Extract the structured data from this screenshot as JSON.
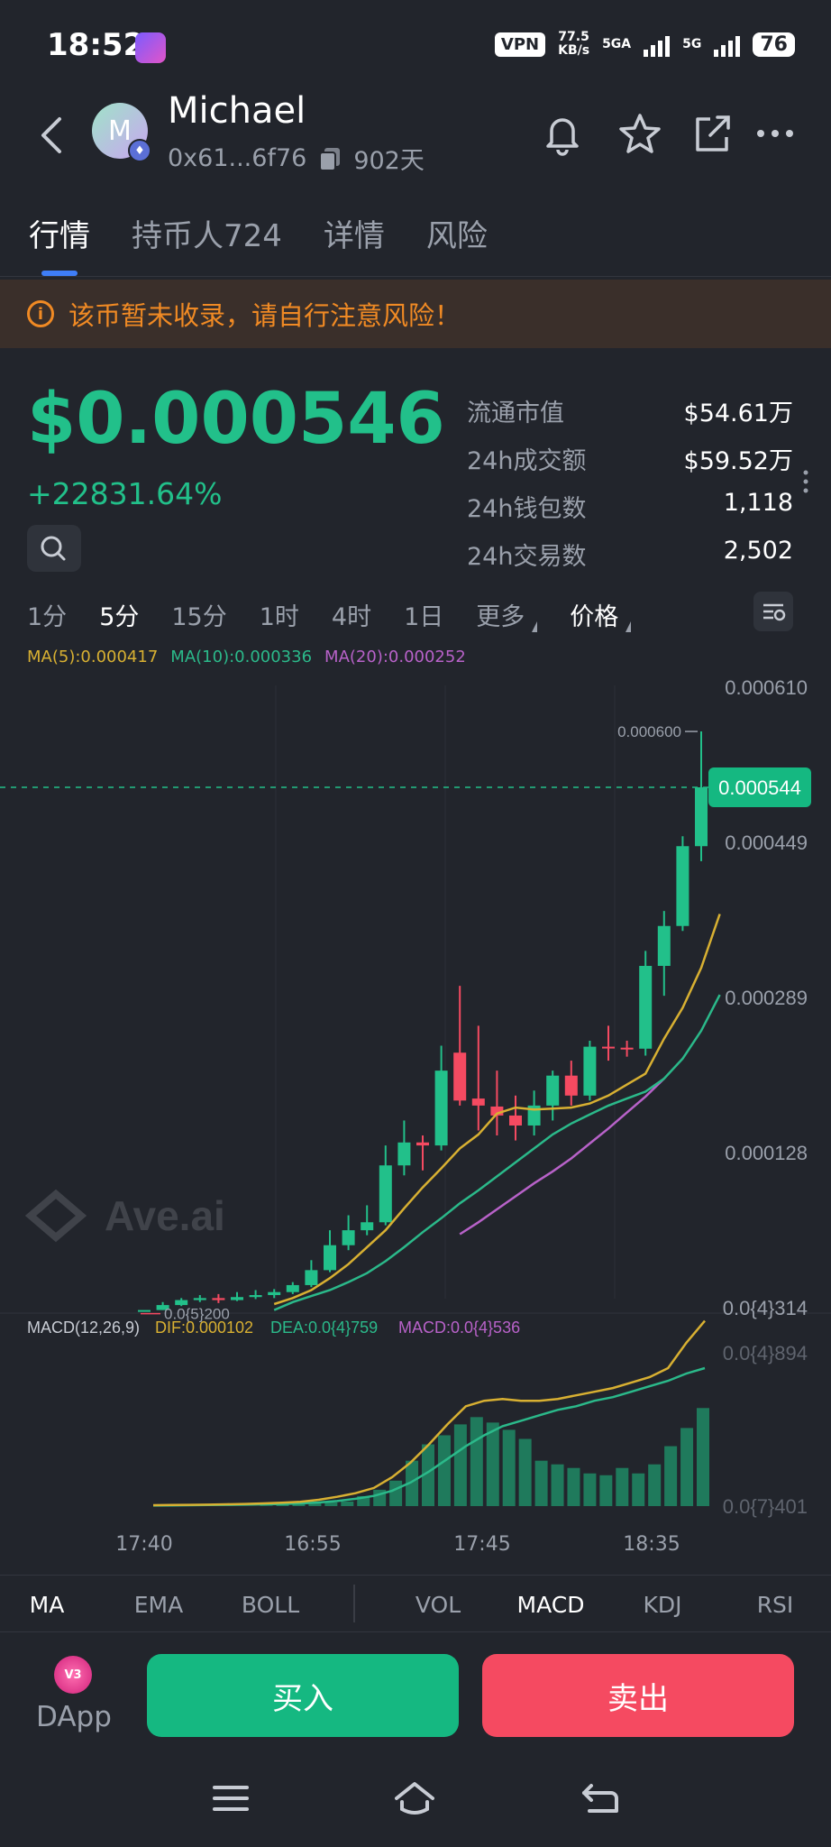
{
  "status_bar": {
    "time": "18:52",
    "vpn": "VPN",
    "net_speed_value": "77.5",
    "net_speed_unit": "KB/s",
    "sim1": "5GA",
    "sim2": "5G",
    "battery": "76"
  },
  "header": {
    "token_name": "Michael",
    "avatar_letter": "M",
    "address": "0x61...6f76",
    "age": "902天"
  },
  "tabs": [
    {
      "label": "行情"
    },
    {
      "label": "持币人724"
    },
    {
      "label": "详情"
    },
    {
      "label": "风险"
    }
  ],
  "warning": {
    "icon": "i",
    "text": "该币暂未收录，请自行注意风险！"
  },
  "price": {
    "value": "$0.000546",
    "change": "+22831.64%"
  },
  "stats": [
    {
      "label": "流通市值",
      "value": "$54.61万"
    },
    {
      "label": "24h成交额",
      "value": "$59.52万"
    },
    {
      "label": "24h钱包数",
      "value": "1,118"
    },
    {
      "label": "24h交易数",
      "value": "2,502"
    }
  ],
  "timeframes": [
    "1分",
    "5分",
    "15分",
    "1时",
    "4时",
    "1日",
    "更多",
    "价格"
  ],
  "ma_legend": [
    {
      "text": "MA(5):0.000417",
      "color": "#d8b032"
    },
    {
      "text": "MA(10):0.000336",
      "color": "#2bb98a"
    },
    {
      "text": "MA(20):0.000252",
      "color": "#b862c9"
    }
  ],
  "chart": {
    "watermark": "Ave.ai",
    "y_labels": [
      "0.000610",
      "0.000449",
      "0.000289",
      "0.000128",
      "0.0{4}314"
    ],
    "current_price_tag": "0.000544",
    "high_marker": "0.000600",
    "low_marker": "0.0{5}200",
    "up_color": "#22c08a",
    "down_color": "#f54a61"
  },
  "chart_data": {
    "type": "candlestick",
    "interval": "5分",
    "candles": [
      {
        "o": 2e-05,
        "c": 2e-05,
        "h": 2e-05,
        "l": 2e-05
      },
      {
        "o": 2e-05,
        "c": 2.5e-05,
        "h": 2.8e-05,
        "l": 2e-05
      },
      {
        "o": 2.5e-05,
        "c": 3e-05,
        "h": 3.2e-05,
        "l": 2.4e-05
      },
      {
        "o": 3e-05,
        "c": 3.2e-05,
        "h": 3.5e-05,
        "l": 2.8e-05
      },
      {
        "o": 3.2e-05,
        "c": 3e-05,
        "h": 3.6e-05,
        "l": 2.7e-05
      },
      {
        "o": 3e-05,
        "c": 3.3e-05,
        "h": 3.8e-05,
        "l": 2.9e-05
      },
      {
        "o": 3.3e-05,
        "c": 3.5e-05,
        "h": 4e-05,
        "l": 3.1e-05
      },
      {
        "o": 3.5e-05,
        "c": 3.8e-05,
        "h": 4.1e-05,
        "l": 3.2e-05
      },
      {
        "o": 3.8e-05,
        "c": 4.5e-05,
        "h": 4.8e-05,
        "l": 3.6e-05
      },
      {
        "o": 4.5e-05,
        "c": 6e-05,
        "h": 7e-05,
        "l": 4.3e-05
      },
      {
        "o": 6e-05,
        "c": 8.5e-05,
        "h": 0.0001,
        "l": 5.8e-05
      },
      {
        "o": 8.5e-05,
        "c": 0.0001,
        "h": 0.000115,
        "l": 8e-05
      },
      {
        "o": 0.0001,
        "c": 0.000108,
        "h": 0.000125,
        "l": 9.5e-05
      },
      {
        "o": 0.000108,
        "c": 0.000165,
        "h": 0.000185,
        "l": 0.000105
      },
      {
        "o": 0.000165,
        "c": 0.000188,
        "h": 0.00021,
        "l": 0.000155
      },
      {
        "o": 0.000188,
        "c": 0.000185,
        "h": 0.000195,
        "l": 0.00016
      },
      {
        "o": 0.000185,
        "c": 0.00026,
        "h": 0.000285,
        "l": 0.00018
      },
      {
        "o": 0.000278,
        "c": 0.00023,
        "h": 0.000345,
        "l": 0.000225
      },
      {
        "o": 0.000232,
        "c": 0.000225,
        "h": 0.000305,
        "l": 0.0002
      },
      {
        "o": 0.000224,
        "c": 0.000215,
        "h": 0.00026,
        "l": 0.000195
      },
      {
        "o": 0.000215,
        "c": 0.000205,
        "h": 0.000235,
        "l": 0.00019
      },
      {
        "o": 0.000205,
        "c": 0.000225,
        "h": 0.00024,
        "l": 0.000195
      },
      {
        "o": 0.000225,
        "c": 0.000255,
        "h": 0.00026,
        "l": 0.00021
      },
      {
        "o": 0.000255,
        "c": 0.000235,
        "h": 0.00027,
        "l": 0.000225
      },
      {
        "o": 0.000235,
        "c": 0.000284,
        "h": 0.00029,
        "l": 0.00023
      },
      {
        "o": 0.000284,
        "c": 0.000283,
        "h": 0.000305,
        "l": 0.00027
      },
      {
        "o": 0.000283,
        "c": 0.000282,
        "h": 0.00029,
        "l": 0.000274
      },
      {
        "o": 0.000282,
        "c": 0.000365,
        "h": 0.00038,
        "l": 0.000275
      },
      {
        "o": 0.000365,
        "c": 0.000405,
        "h": 0.00042,
        "l": 0.000335
      },
      {
        "o": 0.000405,
        "c": 0.000485,
        "h": 0.000495,
        "l": 0.0004
      },
      {
        "o": 0.000485,
        "c": 0.000544,
        "h": 0.0006,
        "l": 0.00047
      }
    ],
    "ma5_start": 7,
    "ma10_start": 7,
    "ma20_start": 17,
    "ma5": [
      2.6e-05,
      3.2e-05,
      4e-05,
      5.2e-05,
      6.6e-05,
      8.3e-05,
      0.0001,
      0.000122,
      0.000143,
      0.000162,
      0.000182,
      0.000196,
      0.000217,
      0.000223,
      0.000221,
      0.000222,
      0.000223,
      0.000227,
      0.000235,
      0.000246,
      0.000257,
      0.000292,
      0.000323,
      0.000363,
      0.000417
    ],
    "ma10": [
      2e-05,
      2.8e-05,
      3.4e-05,
      4e-05,
      4.8e-05,
      5.7e-05,
      6.9e-05,
      8.3e-05,
      9.8e-05,
      0.000112,
      0.000127,
      0.00014,
      0.000154,
      0.000168,
      0.000182,
      0.000196,
      0.000207,
      0.000216,
      0.000225,
      0.000232,
      0.000239,
      0.000252,
      0.000272,
      0.0003,
      0.000336
    ],
    "ma20": [
      9.6e-05,
      0.000108,
      0.000121,
      0.000134,
      0.000147,
      0.000159,
      0.000172,
      0.000187,
      0.000202,
      0.000218,
      0.000234,
      0.000252
    ]
  },
  "macd": {
    "legend_title": "MACD(12,26,9)",
    "dif": "DIF:0.000102",
    "dea": "DEA:0.0{4}759",
    "macd": "MACD:0.0{4}536",
    "dif_color": "#d8b032",
    "dea_color": "#2bb98a",
    "macd_color": "#b862c9",
    "y_top": "0.0{4}894",
    "y_bottom": "0.0{7}401",
    "hist": [
      0,
      0,
      0,
      0,
      0,
      0,
      2e-08,
      3e-07,
      8e-07,
      1.2e-06,
      1.6e-06,
      2e-06,
      2.5e-06,
      5.5e-06,
      9e-06,
      1.4e-05,
      2.5e-05,
      3.4e-05,
      3.9e-05,
      4.5e-05,
      4.9e-05,
      4.6e-05,
      4.2e-05,
      3.7e-05,
      2.5e-05,
      2.3e-05,
      2.1e-05,
      1.8e-05,
      1.7e-05,
      2.1e-05,
      1.8e-05,
      2.3e-05,
      3.3e-05,
      4.3e-05,
      5.4e-05
    ],
    "dif_line": [
      5e-07,
      6e-07,
      7e-07,
      8e-07,
      1e-06,
      1.2e-06,
      1.5e-06,
      1.9e-06,
      2.4e-06,
      3.5e-06,
      5.1e-06,
      7.1e-06,
      1e-05,
      1.6e-05,
      2.4e-05,
      3.4e-05,
      4.5e-05,
      5.5e-05,
      5.8e-05,
      5.9e-05,
      5.8e-05,
      5.8e-05,
      5.9e-05,
      6.1e-05,
      6.3e-05,
      6.5e-05,
      6.8e-05,
      7.1e-05,
      7.6e-05,
      9e-05,
      0.000102
    ],
    "dea_line": [
      3e-07,
      4e-07,
      5e-07,
      6e-07,
      7e-07,
      8e-07,
      1e-06,
      1.2e-06,
      1.5e-06,
      2e-06,
      2.8e-06,
      4e-06,
      5.6e-06,
      8.5e-06,
      1.3e-05,
      1.9e-05,
      2.6e-05,
      3.3e-05,
      3.9e-05,
      4.4e-05,
      4.7e-05,
      5e-05,
      5.3e-05,
      5.5e-05,
      5.8e-05,
      6e-05,
      6.3e-05,
      6.6e-05,
      6.9e-05,
      7.3e-05,
      7.6e-05
    ]
  },
  "x_axis": [
    "17:40",
    "16:55",
    "17:45",
    "18:35"
  ],
  "indicators_left": [
    "MA",
    "EMA",
    "BOLL"
  ],
  "indicators_right": [
    "VOL",
    "MACD",
    "KDJ",
    "RSI"
  ],
  "actions": {
    "dapp_badge": "V3",
    "dapp_label": "DApp",
    "buy": "买入",
    "sell": "卖出"
  }
}
